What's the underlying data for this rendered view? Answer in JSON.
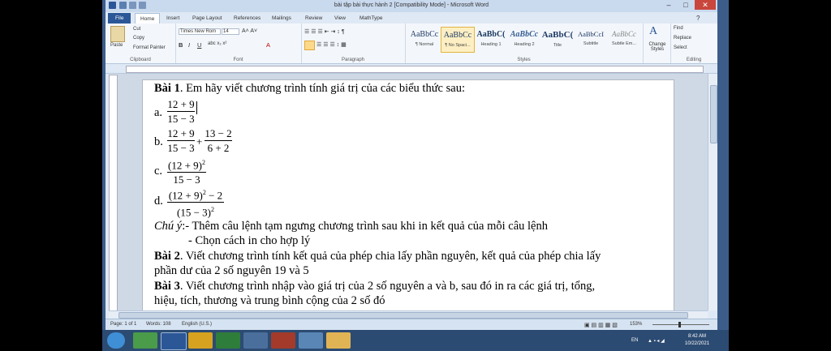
{
  "window": {
    "title": "bài tập bài thực hành 2 [Compatibility Mode] - Microsoft Word",
    "controls": {
      "minimize": "–",
      "maximize": "□",
      "close": "✕"
    }
  },
  "ribbon_tabs": [
    "File",
    "Home",
    "Insert",
    "Page Layout",
    "References",
    "Mailings",
    "Review",
    "View",
    "MathType"
  ],
  "ribbon": {
    "clipboard": {
      "label": "Clipboard",
      "paste": "Paste",
      "cut": "Cut",
      "copy": "Copy",
      "format_painter": "Format Painter"
    },
    "font": {
      "label": "Font",
      "name": "Times New Rom",
      "size": "14"
    },
    "paragraph": {
      "label": "Paragraph"
    },
    "styles": {
      "label": "Styles",
      "items": [
        {
          "preview": "AaBbCc",
          "name": "¶ Normal"
        },
        {
          "preview": "AaBbCc",
          "name": "¶ No Spaci..."
        },
        {
          "preview": "AaBbC(",
          "name": "Heading 1"
        },
        {
          "preview": "AaBbCc",
          "name": "Heading 2"
        },
        {
          "preview": "AaBbC(",
          "name": "Title"
        },
        {
          "preview": "AaBbCcI",
          "name": "Subtitle"
        },
        {
          "preview": "AaBbCc",
          "name": "Subtle Em..."
        }
      ],
      "change_styles": "Change Styles"
    },
    "editing": {
      "label": "Editing",
      "find": "Find",
      "replace": "Replace",
      "select": "Select"
    }
  },
  "document": {
    "bai1": {
      "label": "Bài 1",
      "text": ". Em hãy viết chương trình tính giá trị của các biểu thức sau:"
    },
    "items": {
      "a": {
        "label": "a.",
        "num": "12 + 9",
        "den": "15 − 3"
      },
      "b": {
        "label": "b.",
        "num1": "12 + 9",
        "den1": "15 − 3",
        "plus": "+",
        "num2": "13 − 2",
        "den2": "6 + 2"
      },
      "c": {
        "label": "c.",
        "num": "(12 + 9)",
        "exp": "2",
        "den": "15 − 3"
      },
      "d": {
        "label": "d.",
        "num": "(12 + 9)",
        "exp": "2",
        "num_tail": " − 2",
        "den": "(15 − 3)",
        "den_exp": "2"
      }
    },
    "chu_y": {
      "label": "Chú ý",
      "line1": ":- Thêm câu lệnh tạm ngưng chương trình sau khi in kết quả của mỗi câu lệnh",
      "line2": "- Chọn cách in cho hợp lý"
    },
    "bai2": {
      "label": "Bài 2",
      "line1": ". Viết chương trình tính kết quả của phép chia lấy phần nguyên, kết quả của phép chia lấy",
      "line2": "phần dư của 2 số nguyên 19 và 5"
    },
    "bai3": {
      "label": "Bài 3",
      "line1": ". Viết chương trình nhập vào giá trị của 2 số nguyên a và b, sau đó in ra các giá trị, tổng,",
      "line2": "hiệu, tích, thương và trung bình cộng của 2 số đó"
    }
  },
  "status": {
    "page": "Page: 1 of 1",
    "words": "Words: 108",
    "language": "English (U.S.)",
    "zoom": "153%"
  },
  "taskbar": {
    "lang": "EN",
    "time": "8:42 AM",
    "date": "10/22/2021"
  }
}
